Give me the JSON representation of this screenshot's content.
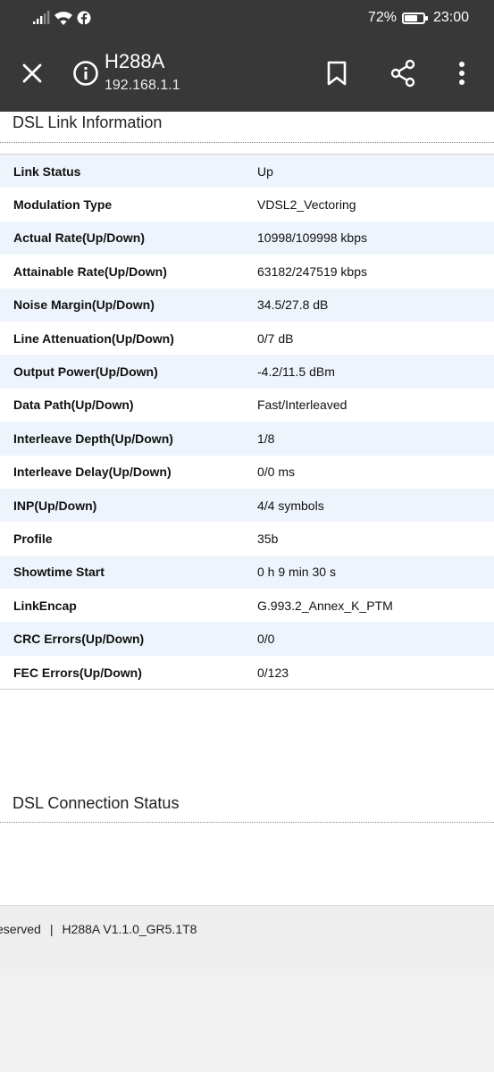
{
  "status_bar": {
    "battery_text": "72%",
    "battery_level": 0.72,
    "time": "23:00",
    "icons": [
      "signal-icon",
      "wifi-icon",
      "facebook-icon",
      "battery-icon"
    ]
  },
  "toolbar": {
    "title": "H288A",
    "url": "192.168.1.1",
    "icons": [
      "close-icon",
      "info-icon",
      "bookmark-icon",
      "share-icon",
      "more-vert-icon"
    ]
  },
  "dsl_info": {
    "title": "DSL Link Information",
    "rows": [
      {
        "label": "Link Status",
        "value": "Up"
      },
      {
        "label": "Modulation Type",
        "value": "VDSL2_Vectoring"
      },
      {
        "label": "Actual Rate(Up/Down)",
        "value": "10998/109998 kbps"
      },
      {
        "label": "Attainable Rate(Up/Down)",
        "value": "63182/247519 kbps"
      },
      {
        "label": "Noise Margin(Up/Down)",
        "value": "34.5/27.8 dB"
      },
      {
        "label": "Line Attenuation(Up/Down)",
        "value": "0/7 dB"
      },
      {
        "label": "Output Power(Up/Down)",
        "value": "-4.2/11.5 dBm"
      },
      {
        "label": "Data Path(Up/Down)",
        "value": "Fast/Interleaved"
      },
      {
        "label": "Interleave Depth(Up/Down)",
        "value": "1/8"
      },
      {
        "label": "Interleave Delay(Up/Down)",
        "value": "0/0 ms"
      },
      {
        "label": "INP(Up/Down)",
        "value": "4/4 symbols"
      },
      {
        "label": "Profile",
        "value": "35b"
      },
      {
        "label": "Showtime Start",
        "value": "0 h 9 min 30 s"
      },
      {
        "label": "LinkEncap",
        "value": "G.993.2_Annex_K_PTM"
      },
      {
        "label": "CRC Errors(Up/Down)",
        "value": "0/0"
      },
      {
        "label": "FEC Errors(Up/Down)",
        "value": "0/123"
      }
    ]
  },
  "dsl_status": {
    "title": "DSL Connection Status"
  },
  "footer": {
    "rights_fragment": "eserved",
    "separator": "|",
    "version": "H288A V1.1.0_GR5.1T8"
  }
}
